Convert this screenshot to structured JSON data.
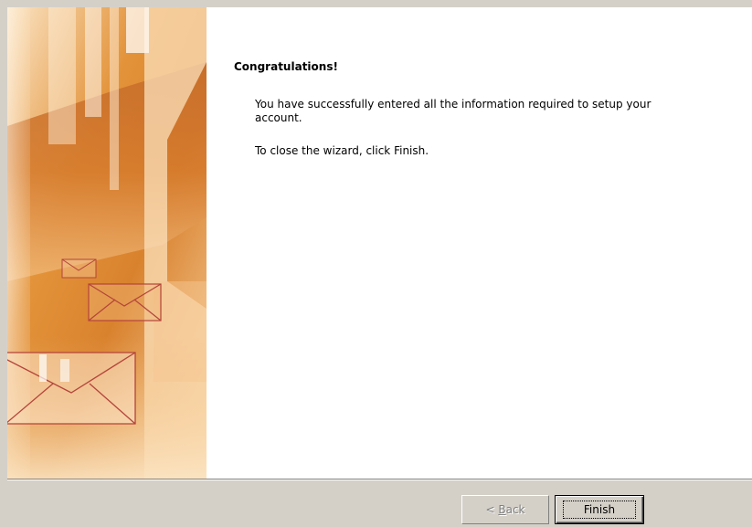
{
  "wizard": {
    "heading": "Congratulations!",
    "message_1": "You have successfully entered all the information required to setup your account.",
    "message_2": "To close the wizard, click Finish."
  },
  "buttons": {
    "back_prefix": "< ",
    "back_accel": "B",
    "back_rest": "ack",
    "finish": "Finish"
  },
  "colors": {
    "dialog_bg": "#d4d0c8",
    "banner_orange": "#e08a2c",
    "envelope_stroke": "#b4443a"
  },
  "icons": [
    "envelope-icon"
  ]
}
